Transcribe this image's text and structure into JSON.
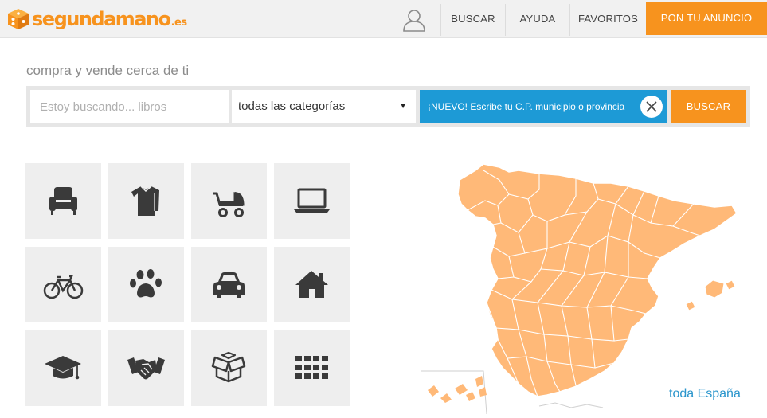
{
  "header": {
    "logo": {
      "name": "segundamano",
      "tld": ".es"
    },
    "nav": {
      "buscar": "BUSCAR",
      "ayuda": "AYUDA",
      "favoritos": "FAVORITOS"
    },
    "cta_label": "PON TU ANUNCIO"
  },
  "main": {
    "tagline": "compra y vende cerca de ti",
    "search": {
      "placeholder": "Estoy buscando... libros",
      "value": "",
      "category": "todas las categorías",
      "location_prompt": "¡NUEVO! Escribe tu C.P. municipio o provincia",
      "button_label": "BUSCAR"
    }
  },
  "categories": [
    {
      "icon": "armchair-icon"
    },
    {
      "icon": "sweater-icon"
    },
    {
      "icon": "baby-stroller-icon"
    },
    {
      "icon": "laptop-icon"
    },
    {
      "icon": "bicycle-icon"
    },
    {
      "icon": "paw-icon"
    },
    {
      "icon": "car-icon"
    },
    {
      "icon": "house-icon"
    },
    {
      "icon": "graduation-cap-icon"
    },
    {
      "icon": "handshake-icon"
    },
    {
      "icon": "open-box-icon"
    },
    {
      "icon": "grid-icon"
    }
  ],
  "map": {
    "region_link": "toda España",
    "colors": {
      "fill": "#ffb978",
      "border": "#ffffff",
      "link": "#2a95cc"
    }
  },
  "colors": {
    "accent": "#f7931e",
    "location_bg": "#1d9ad6",
    "topbar_bg": "#f1f1f1",
    "tile_bg": "#eeeeee",
    "icon": "#3a3a3a"
  }
}
